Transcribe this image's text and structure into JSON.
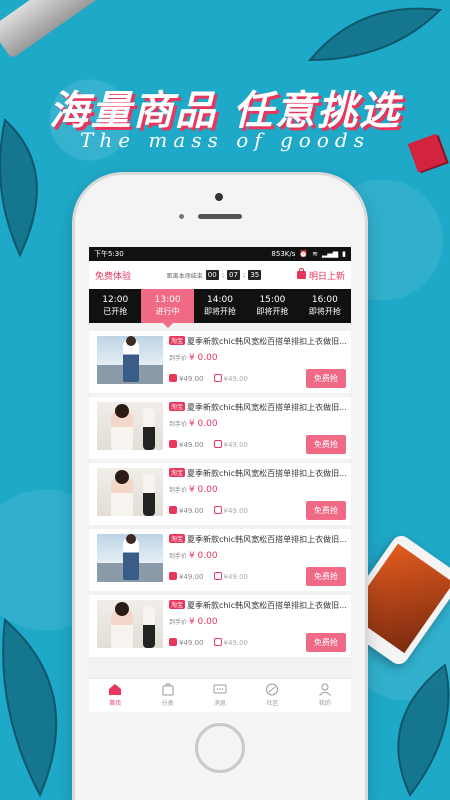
{
  "banner": {
    "headline": "海量商品 任意挑选",
    "subline": "The mass of goods"
  },
  "status_bar": {
    "time": "下午5:30",
    "speed": "853K/s"
  },
  "header": {
    "free_trial": "免费体验",
    "countdown_label": "距离本场结束",
    "countdown": [
      "00",
      "07",
      "35"
    ],
    "tomorrow": "明日上新"
  },
  "tabs": [
    {
      "time": "12:00",
      "status": "已开抢"
    },
    {
      "time": "13:00",
      "status": "进行中"
    },
    {
      "time": "14:00",
      "status": "即将开抢"
    },
    {
      "time": "15:00",
      "status": "即将开抢"
    },
    {
      "time": "16:00",
      "status": "即将开抢"
    }
  ],
  "items": [
    {
      "tag": "淘宝",
      "title": "夏季新款chic韩风宽松百搭单排扣上衣做旧...",
      "price_label": "到手价",
      "price": "¥ 0.00",
      "taobao_price": "¥49.00",
      "original_price": "¥49.00",
      "button": "免费抢"
    },
    {
      "tag": "淘宝",
      "title": "夏季新款chic韩风宽松百搭单排扣上衣做旧...",
      "price_label": "到手价",
      "price": "¥ 0.00",
      "taobao_price": "¥49.00",
      "original_price": "¥49.00",
      "button": "免费抢"
    },
    {
      "tag": "淘宝",
      "title": "夏季新款chic韩风宽松百搭单排扣上衣做旧...",
      "price_label": "到手价",
      "price": "¥ 0.00",
      "taobao_price": "¥49.00",
      "original_price": "¥49.00",
      "button": "免费抢"
    },
    {
      "tag": "淘宝",
      "title": "夏季新款chic韩风宽松百搭单排扣上衣做旧...",
      "price_label": "到手价",
      "price": "¥ 0.00",
      "taobao_price": "¥49.00",
      "original_price": "¥49.00",
      "button": "免费抢"
    },
    {
      "tag": "淘宝",
      "title": "夏季新款chic韩风宽松百搭单排扣上衣做旧...",
      "price_label": "到手价",
      "price": "¥ 0.00",
      "taobao_price": "¥49.00",
      "original_price": "¥49.00",
      "button": "免费抢"
    }
  ],
  "nav": [
    {
      "label": "首页",
      "icon": "home-icon"
    },
    {
      "label": "分类",
      "icon": "category-icon"
    },
    {
      "label": "消息",
      "icon": "message-icon"
    },
    {
      "label": "社区",
      "icon": "community-icon"
    },
    {
      "label": "我的",
      "icon": "profile-icon"
    }
  ],
  "colors": {
    "accent": "#e8365d",
    "background": "#1fa9c9"
  }
}
